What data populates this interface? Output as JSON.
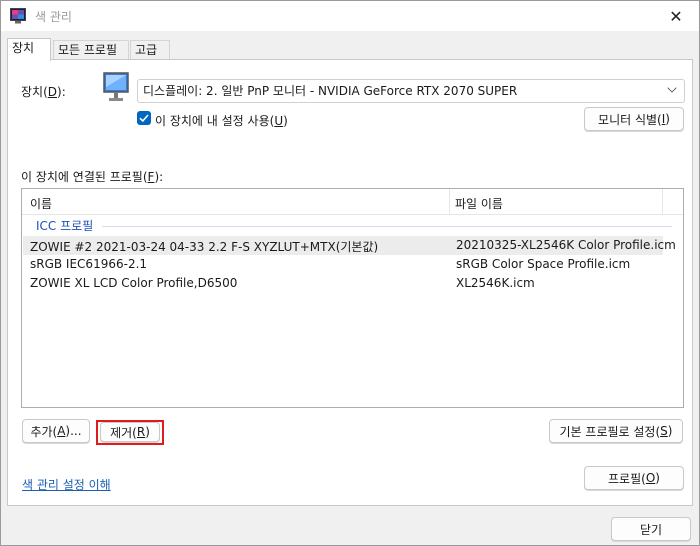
{
  "window": {
    "title": "색 관리",
    "close_glyph": "✕"
  },
  "tabs": [
    {
      "label": "장치",
      "active": true
    },
    {
      "label": "모든 프로필",
      "active": false
    },
    {
      "label": "고급",
      "active": false
    }
  ],
  "device": {
    "label": "장치(",
    "label_key": "D",
    "label_end": "):",
    "selected": "디스플레이: 2. 일반 PnP 모니터 - NVIDIA GeForce RTX 2070 SUPER",
    "use_settings_label": "이 장치에 내 설정 사용(",
    "use_settings_key": "U",
    "use_settings_end": ")",
    "use_settings_checked": true,
    "identify_label": "모니터 식별(",
    "identify_key": "I",
    "identify_end": ")"
  },
  "profiles": {
    "label": "이 장치에 연결된 프로필(",
    "label_key": "F",
    "label_end": "):",
    "columns": [
      "이름",
      "파일 이름"
    ],
    "group": "ICC 프로필",
    "rows": [
      {
        "name": "ZOWIE #2 2021-03-24 04-33 2.2 F-S XYZLUT+MTX(기본값)",
        "file": "20210325-XL2546K Color Profile.icm",
        "selected": true
      },
      {
        "name": "sRGB IEC61966-2.1",
        "file": "sRGB Color Space Profile.icm",
        "selected": false
      },
      {
        "name": "ZOWIE XL LCD Color Profile,D6500",
        "file": "XL2546K.icm",
        "selected": false
      }
    ]
  },
  "buttons": {
    "add": {
      "label": "추가(",
      "key": "A",
      "end": ")..."
    },
    "remove": {
      "label": "제거(",
      "key": "R",
      "end": ")"
    },
    "set_default": {
      "label": "기본 프로필로 설정(",
      "key": "S",
      "end": ")"
    },
    "profile": {
      "label": "프로필(",
      "key": "O",
      "end": ")"
    },
    "close": {
      "label": "닫기"
    }
  },
  "link": {
    "label": "색 관리 설정 이해"
  },
  "colors": {
    "accent": "#0067c0",
    "highlight_border": "#e01b1b",
    "link": "#1a5fb4"
  }
}
